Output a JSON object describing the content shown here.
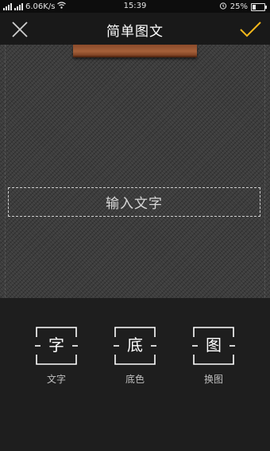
{
  "status_bar": {
    "carrier": "",
    "speed": "6.06K/s",
    "time": "15:39",
    "battery": "25%",
    "battery_level": 0.25
  },
  "header": {
    "title": "简单图文",
    "close_icon": "close-icon",
    "confirm_icon": "checkmark-icon",
    "accent_color": "#f5b81b"
  },
  "canvas": {
    "placeholder": "输入文字"
  },
  "toolbar": {
    "items": [
      {
        "glyph": "字",
        "label": "文字",
        "icon": "text-icon"
      },
      {
        "glyph": "底",
        "label": "底色",
        "icon": "background-icon"
      },
      {
        "glyph": "图",
        "label": "换图",
        "icon": "image-icon"
      }
    ]
  }
}
